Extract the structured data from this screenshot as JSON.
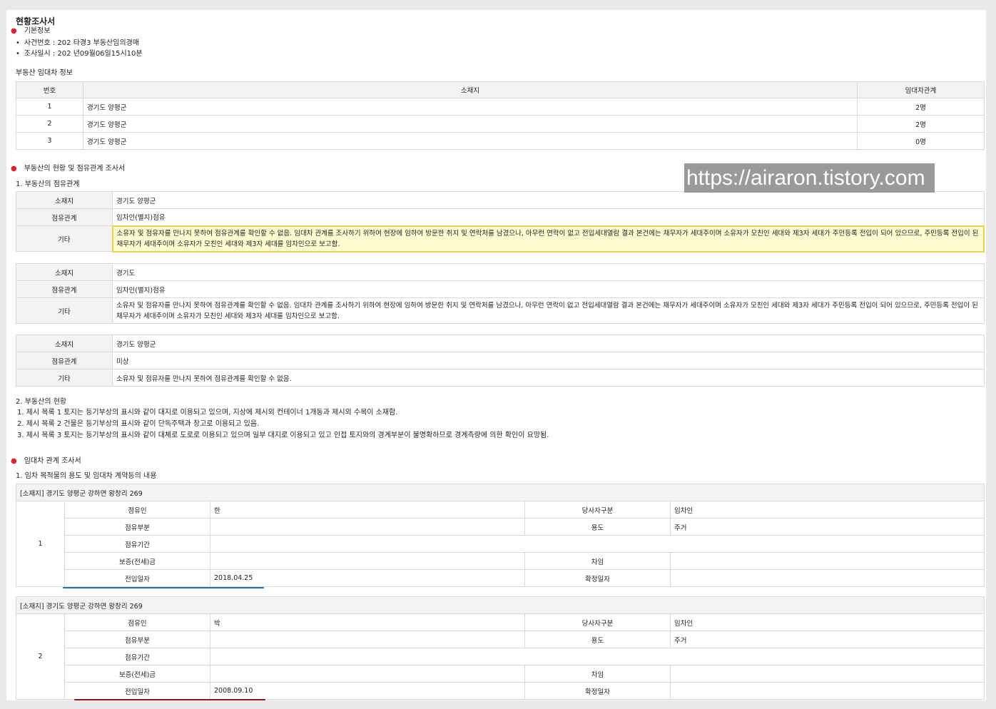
{
  "title": "현황조사서",
  "basic": {
    "heading": "기본정보",
    "case_no": "사건번호 : 202  타경3       부동산임의경매",
    "survey_date": "조사일시 : 202  년09월06일15시10분"
  },
  "tenant_info": {
    "heading": "부동산 임대차 정보",
    "columns": [
      "번호",
      "소재지",
      "임대차관계"
    ],
    "rows": [
      [
        "1",
        "경기도 양평군",
        "2명"
      ],
      [
        "2",
        "경기도 양평군",
        "2명"
      ],
      [
        "3",
        "경기도 양평군",
        "0명"
      ]
    ]
  },
  "status_survey": {
    "heading": "부동산의 현황 및 점유관계 조사서",
    "occupancy_heading": "1. 부동산의 점유관계",
    "labels": {
      "location": "소재지",
      "relation": "점유관계",
      "other": "기타"
    },
    "blocks": [
      {
        "location": "경기도 양평군",
        "relation": "임차인(별지)점유",
        "other": "소유자 및 점유자를 만나지 못하여 점유관계를 확인할 수 없음. 임대차 관계를 조사하기 위하여 현장에 임하여 방문한 취지 및 연락처를 남겼으나, 아무런 연락이 없고 전입세대열람 결과 본건에는 채무자가 세대주이며 소유자가 모친인 세대와 제3자 세대가 주민등록 전입이 되어 있으므로, 주민등록 전입이 된 채무자가 세대주이며 소유자가 모친인 세대와 제3자 세대를 임차인으로 보고함."
      },
      {
        "location": "경기도",
        "relation": "임차인(별지)점유",
        "other": "소유자 및 점유자를 만나지 못하여 점유관계를 확인할 수 없음. 임대차 관계를 조사하기 위하여 현장에 임하여 방문한 취지 및 연락처를 남겼으나, 아무런 연락이 없고 전입세대열람 결과 본건에는 채무자가 세대주이며 소유자가 모친인 세대와 제3자 세대가 주민등록 전입이 되어 있으므로, 주민등록 전입이 된 채무자가 세대주이며 소유자가 모친인 세대와 제3자 세대를 임차인으로 보고함."
      },
      {
        "location": "경기도 양평군 ",
        "relation": "미상",
        "other": "소유자 및 점유자를 만나지 못하여 점유관계를 확인할 수 없음."
      }
    ],
    "condition_heading": "2. 부동산의 현황",
    "conditions": [
      "1. 제시 목록 1 토지는 등기부상의 표시와 같이 대지로 이용되고 있으며, 지상에 제시외 컨테이너 1개동과 제시외 수목이 소재함.",
      "2. 제시 목록 2 건물은 등기부상의 표시와 같이 단독주택과 창고로 이용되고 있음.",
      "3. 제시 목록 3 토지는 등기부상의 표시와 같이 대체로 도로로 이용되고 있으며 일부 대지로 이용되고 있고 인접 토지와의 경계부분이 불명확하므로 경계측량에 의한 확인이 요망됨."
    ]
  },
  "lease_survey": {
    "heading": "임대차 관계 조사서",
    "sub_heading": "1. 임차 목적물의 용도 및 임대차 계약등의 내용",
    "labels": {
      "occupant": "점유인",
      "party_type": "당사자구분",
      "part": "점유부분",
      "use": "용도",
      "period": "점유기간",
      "deposit": "보증(전세)금",
      "rent": "차임",
      "move_in": "전입일자",
      "confirm": "확정일자"
    },
    "entries": [
      {
        "caption": "[소재지] 경기도 양평군 강하면 왕창리 269",
        "no": "1",
        "occupant": "한",
        "party_type": "임차인",
        "part": "",
        "use": "주거",
        "period": "",
        "deposit": "",
        "rent": "",
        "move_in": "2018.04.25",
        "confirm": ""
      },
      {
        "caption": "[소재지] 경기도 양평군 강하면 왕창리 269",
        "no": "2",
        "occupant": "박",
        "party_type": "임차인",
        "part": "",
        "use": "주거",
        "period": "",
        "deposit": "",
        "rent": "",
        "move_in": "2008.09.10",
        "confirm": ""
      }
    ]
  },
  "watermark": "https://airaron.tistory.com",
  "colors": {
    "highlight_bg": "#fffbd0",
    "highlight_border": "#e8d24e",
    "bullet_dot": "#dd2233",
    "underline_blue": "#1f6fb5",
    "underline_red": "#8b1a1a"
  }
}
